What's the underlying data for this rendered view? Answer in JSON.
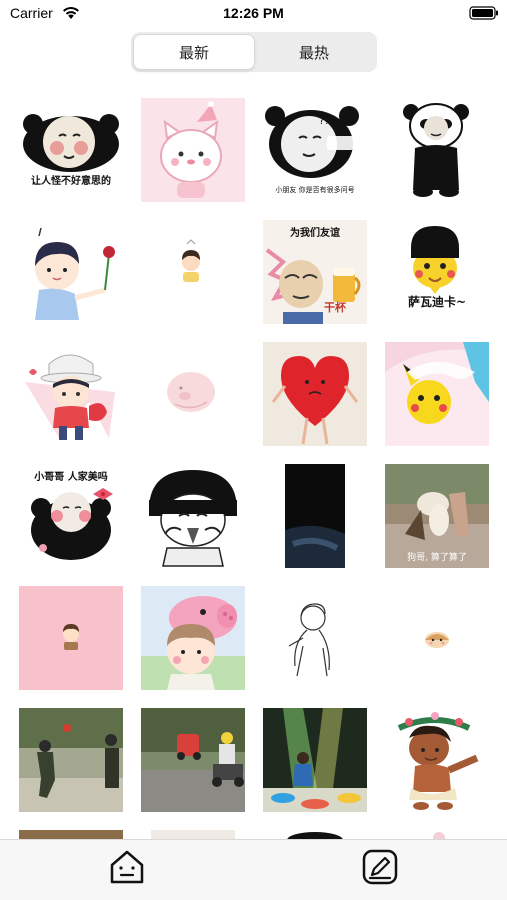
{
  "status_bar": {
    "carrier": "Carrier",
    "time": "12:26 PM",
    "icons": [
      "wifi-icon",
      "battery-icon"
    ]
  },
  "segment": {
    "tabs": [
      {
        "label": "最新",
        "selected": true
      },
      {
        "label": "最热",
        "selected": false
      }
    ]
  },
  "grid": {
    "items": [
      {
        "caption": "让人怪不好意思的",
        "image": "panda-blush-meme"
      },
      {
        "caption": "",
        "image": "pink-cat-party-hat"
      },
      {
        "caption": "小朋友 你是否有很多问号",
        "image": "panda-question-marks"
      },
      {
        "caption": "",
        "image": "panda-standing"
      },
      {
        "caption": "",
        "image": "boy-holding-rose"
      },
      {
        "caption": "",
        "image": "tiny-cartoon-boy"
      },
      {
        "caption": "为我们友谊",
        "caption2": "干杯",
        "image": "cheers-beer-meme"
      },
      {
        "caption": "萨瓦迪卡~",
        "image": "pikachu-bowl-cut"
      },
      {
        "caption": "",
        "image": "chibi-boy-bucket-hat"
      },
      {
        "caption": "",
        "image": "pink-blob"
      },
      {
        "caption": "",
        "image": "red-heart-legs"
      },
      {
        "caption": "",
        "image": "pikachu-under-blanket"
      },
      {
        "caption": "小哥哥 人家美吗",
        "image": "panda-bow"
      },
      {
        "caption": "",
        "image": "bowl-cut-crying"
      },
      {
        "caption": "",
        "image": "dark-photo"
      },
      {
        "caption": "狗哥, 算了算了",
        "image": "dog-photo"
      },
      {
        "caption": "",
        "image": "pink-tiny-boy"
      },
      {
        "caption": "",
        "image": "peppa-pig-girl"
      },
      {
        "caption": "",
        "image": "line-drawing-person"
      },
      {
        "caption": "",
        "image": "hamster"
      },
      {
        "caption": "",
        "image": "kids-photo"
      },
      {
        "caption": "",
        "image": "kids-toy-car-photo"
      },
      {
        "caption": "",
        "image": "child-spotlight-photo"
      },
      {
        "caption": "",
        "image": "moana-character"
      }
    ]
  },
  "tab_bar": {
    "items": [
      {
        "name": "home-icon"
      },
      {
        "name": "edit-icon"
      }
    ]
  }
}
